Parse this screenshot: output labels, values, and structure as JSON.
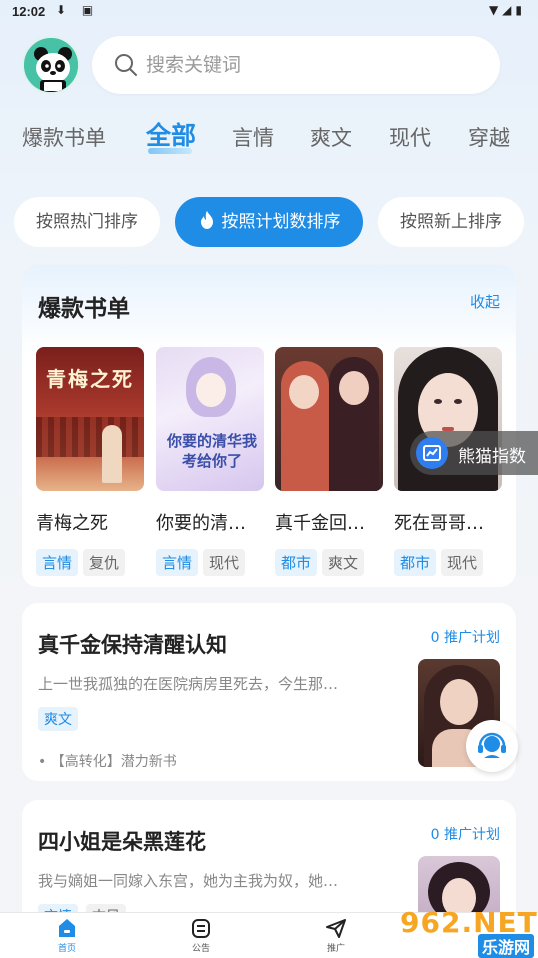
{
  "status": {
    "time": "12:02"
  },
  "search": {
    "placeholder": "搜索关键词"
  },
  "tabs": [
    {
      "label": "爆款书单"
    },
    {
      "label": "全部"
    },
    {
      "label": "言情"
    },
    {
      "label": "爽文"
    },
    {
      "label": "现代"
    },
    {
      "label": "穿越"
    }
  ],
  "sort": [
    {
      "label": "按照热门排序"
    },
    {
      "label": "按照计划数排序"
    },
    {
      "label": "按照新上排序"
    }
  ],
  "booklist": {
    "title": "爆款书单",
    "collapse": "收起",
    "books": [
      {
        "cover_text": "青梅之死",
        "title": "青梅之死",
        "tags": [
          "言情",
          "复仇"
        ]
      },
      {
        "cover_text": "你要的清华我考给你了",
        "title": "你要的清…",
        "tags": [
          "言情",
          "现代"
        ]
      },
      {
        "title": "真千金回…",
        "tags": [
          "都市",
          "爽文"
        ]
      },
      {
        "title": "死在哥哥…",
        "tags": [
          "都市",
          "现代"
        ]
      }
    ]
  },
  "float_button": {
    "label": "熊猫指数"
  },
  "promos": [
    {
      "title": "真千金保持清醒认知",
      "plan": "0 推广计划",
      "desc": "上一世我孤独的在医院病房里死去，今生那…",
      "tags": [
        "爽文"
      ],
      "extra": "【高转化】潜力新书"
    },
    {
      "title": "四小姐是朵黑莲花",
      "plan": "0 推广计划",
      "desc": "我与嫡姐一同嫁入东宫，她为主我为奴，她…",
      "tags": [
        "言情",
        "古风"
      ]
    }
  ],
  "nav": [
    {
      "label": "首页"
    },
    {
      "label": "公告"
    },
    {
      "label": "推广"
    }
  ],
  "watermark": {
    "text": "962.NET",
    "sub": "乐游网"
  },
  "colors": {
    "accent": "#1f8ce6"
  }
}
